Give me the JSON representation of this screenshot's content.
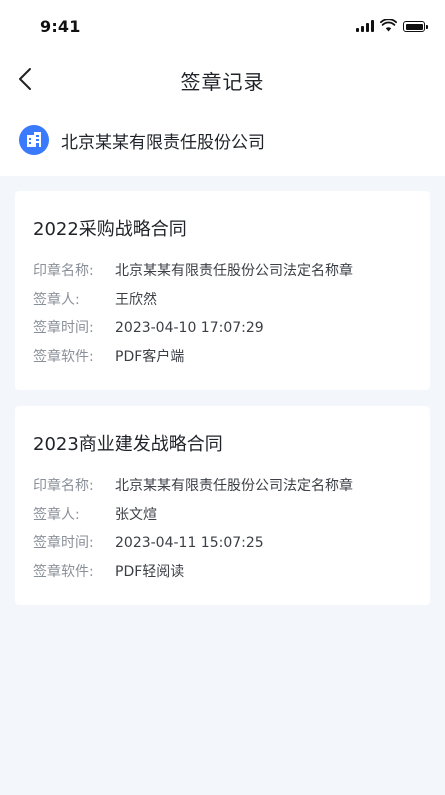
{
  "status_bar": {
    "time": "9:41"
  },
  "nav": {
    "title": "签章记录"
  },
  "company": {
    "name": "北京某某有限责任股份公司"
  },
  "labels": {
    "seal_name": "印章名称:",
    "signer": "签章人:",
    "sign_time": "签章时间:",
    "software": "签章软件:"
  },
  "records": [
    {
      "title": "2022采购战略合同",
      "seal_name": "北京某某有限责任股份公司法定名称章",
      "signer": "王欣然",
      "sign_time": "2023-04-10 17:07:29",
      "software": "PDF客户端"
    },
    {
      "title": "2023商业建发战略合同",
      "seal_name": "北京某某有限责任股份公司法定名称章",
      "signer": "张文煊",
      "sign_time": "2023-04-11 15:07:25",
      "software": "PDF轻阅读"
    }
  ],
  "colors": {
    "accent": "#3a7afe",
    "background": "#f3f6fb",
    "card": "#ffffff",
    "label": "#8a9099"
  },
  "icons": {
    "back": "chevron-left-icon",
    "company": "building-icon",
    "signal": "cellular-signal-icon",
    "wifi": "wifi-icon",
    "battery": "battery-icon"
  }
}
